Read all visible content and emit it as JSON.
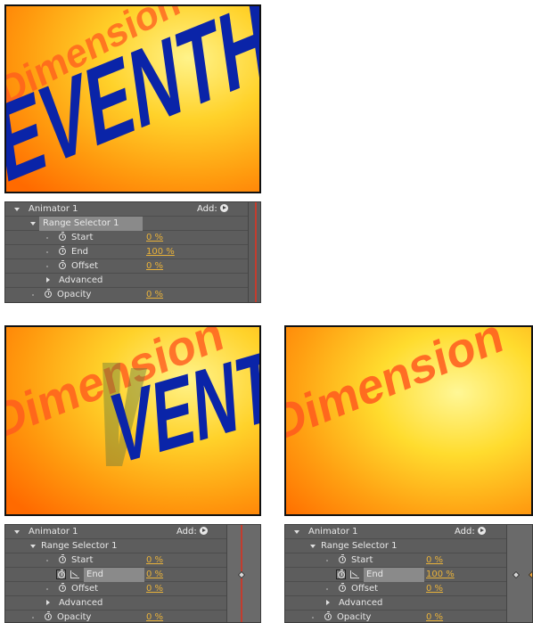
{
  "previews": {
    "top": {
      "text_solid": "SEVENTH",
      "text_ghost": "Dimension"
    },
    "bottom_left": {
      "text_solid": "VENTH",
      "text_ghost": "Dimension"
    },
    "bottom_right": {
      "text_ghost": "Dimension"
    }
  },
  "panels": {
    "top": {
      "group": "Animator 1",
      "add_label": "Add:",
      "selector": "Range Selector 1",
      "props": [
        {
          "name": "Start",
          "value": "0 %"
        },
        {
          "name": "End",
          "value": "100 %"
        },
        {
          "name": "Offset",
          "value": "0 %"
        }
      ],
      "advanced": "Advanced",
      "opacity": {
        "name": "Opacity",
        "value": "0 %"
      }
    },
    "bottom_left": {
      "group": "Animator 1",
      "add_label": "Add:",
      "selector": "Range Selector 1",
      "props": [
        {
          "name": "Start",
          "value": "0 %"
        },
        {
          "name": "End",
          "value": "0 %"
        },
        {
          "name": "Offset",
          "value": "0 %"
        }
      ],
      "advanced": "Advanced",
      "opacity": {
        "name": "Opacity",
        "value": "0 %"
      }
    },
    "bottom_right": {
      "group": "Animator 1",
      "add_label": "Add:",
      "selector": "Range Selector 1",
      "props": [
        {
          "name": "Start",
          "value": "0 %"
        },
        {
          "name": "End",
          "value": "100 %"
        },
        {
          "name": "Offset",
          "value": "0 %"
        }
      ],
      "advanced": "Advanced",
      "opacity": {
        "name": "Opacity",
        "value": "0 %"
      }
    }
  },
  "colors": {
    "text_blue": "#0a24a8",
    "text_ghost": "#ff5a1e",
    "value_orange": "#e9b23a",
    "panel_bg": "#5d5d5d",
    "time_indicator": "#c43c2e"
  }
}
